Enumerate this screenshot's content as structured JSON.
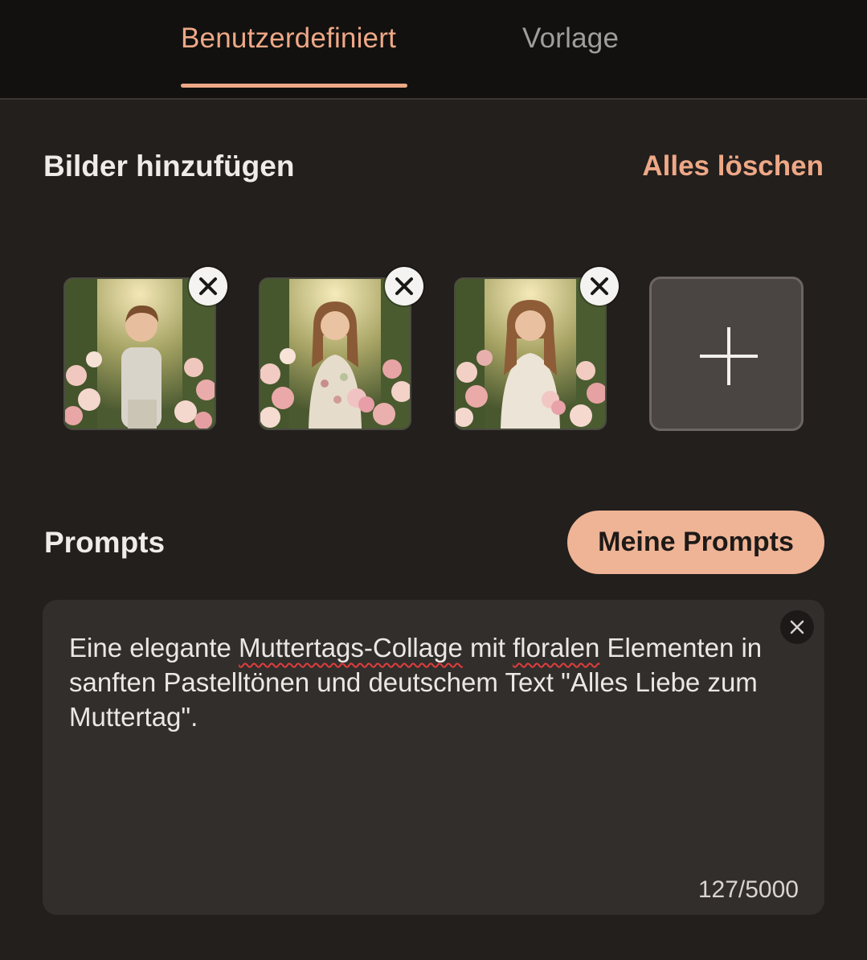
{
  "tabs": [
    {
      "label": "Benutzerdefiniert",
      "active": true
    },
    {
      "label": "Vorlage",
      "active": false
    }
  ],
  "images_section": {
    "title": "Bilder hinzufügen",
    "clear_all": "Alles löschen",
    "thumbnails": [
      {
        "subject": "boy in garden"
      },
      {
        "subject": "girl in garden"
      },
      {
        "subject": "woman in garden"
      }
    ]
  },
  "prompts_section": {
    "title": "Prompts",
    "my_prompts_button": "Meine Prompts",
    "prompt_parts": [
      "Eine elegante ",
      "Muttertags-Collage",
      " mit ",
      "floralen",
      " Elementen in sanften Pastelltönen und deutschem Text \"Alles Liebe zum Muttertag\"."
    ],
    "char_count": "127/5000"
  },
  "colors": {
    "accent": "#eea886",
    "background": "#231f1d",
    "topbar": "#121110",
    "input_bg": "#322e2c",
    "button_bg": "#efb495"
  }
}
